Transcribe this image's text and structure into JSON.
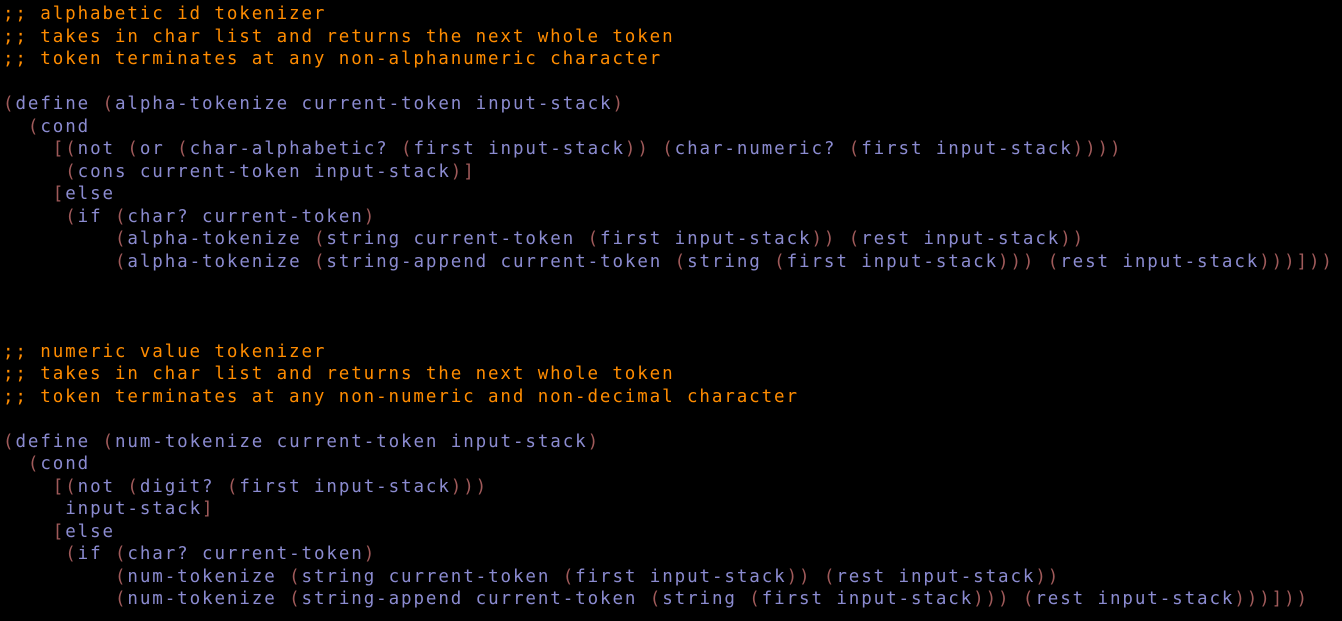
{
  "theme": {
    "background": "#000000",
    "comment_color": "#ff8c00",
    "code_color": "#8b8bd0",
    "paren_color": "#a05a5a"
  },
  "editor": {
    "lines": [
      {
        "kind": "comment",
        "text": ";; alphabetic id tokenizer"
      },
      {
        "kind": "comment",
        "text": ";; takes in char list and returns the next whole token"
      },
      {
        "kind": "comment",
        "text": ";; token terminates at any non-alphanumeric character"
      },
      {
        "kind": "blank",
        "text": ""
      },
      {
        "kind": "code",
        "text": "(define (alpha-tokenize current-token input-stack)"
      },
      {
        "kind": "code",
        "text": "  (cond"
      },
      {
        "kind": "code",
        "text": "    [(not (or (char-alphabetic? (first input-stack)) (char-numeric? (first input-stack))))"
      },
      {
        "kind": "code",
        "text": "     (cons current-token input-stack)]"
      },
      {
        "kind": "code",
        "text": "    [else"
      },
      {
        "kind": "code",
        "text": "     (if (char? current-token)"
      },
      {
        "kind": "code",
        "text": "         (alpha-tokenize (string current-token (first input-stack)) (rest input-stack))"
      },
      {
        "kind": "code",
        "text": "         (alpha-tokenize (string-append current-token (string (first input-stack))) (rest input-stack)))]))"
      },
      {
        "kind": "blank",
        "text": ""
      },
      {
        "kind": "blank",
        "text": ""
      },
      {
        "kind": "blank",
        "text": ""
      },
      {
        "kind": "comment",
        "text": ";; numeric value tokenizer"
      },
      {
        "kind": "comment",
        "text": ";; takes in char list and returns the next whole token"
      },
      {
        "kind": "comment",
        "text": ";; token terminates at any non-numeric and non-decimal character"
      },
      {
        "kind": "blank",
        "text": ""
      },
      {
        "kind": "code",
        "text": "(define (num-tokenize current-token input-stack)"
      },
      {
        "kind": "code",
        "text": "  (cond"
      },
      {
        "kind": "code",
        "text": "    [(not (digit? (first input-stack)))"
      },
      {
        "kind": "code",
        "text": "     input-stack]"
      },
      {
        "kind": "code",
        "text": "    [else"
      },
      {
        "kind": "code",
        "text": "     (if (char? current-token)"
      },
      {
        "kind": "code",
        "text": "         (num-tokenize (string current-token (first input-stack)) (rest input-stack))"
      },
      {
        "kind": "code",
        "text": "         (num-tokenize (string-append current-token (string (first input-stack))) (rest input-stack)))]))"
      }
    ]
  }
}
